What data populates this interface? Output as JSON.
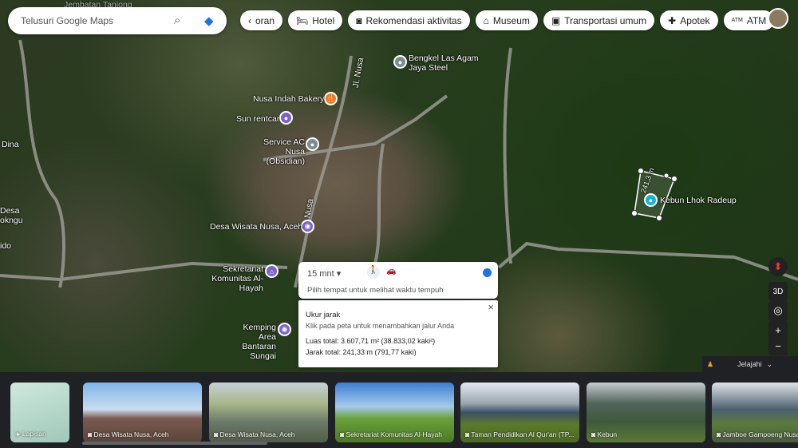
{
  "search": {
    "placeholder": "Telusuri Google Maps",
    "search_icon": "search-icon",
    "directions_icon": "directions-icon"
  },
  "chips": [
    {
      "label": "oran",
      "icon": "chevron-left"
    },
    {
      "label": "Hotel",
      "icon": "bed"
    },
    {
      "label": "Rekomendasi aktivitas",
      "icon": "camera"
    },
    {
      "label": "Museum",
      "icon": "museum"
    },
    {
      "label": "Transportasi umum",
      "icon": "bus"
    },
    {
      "label": "Apotek",
      "icon": "pharmacy"
    },
    {
      "label": "ATM",
      "icon": "atm"
    }
  ],
  "map_labels": {
    "bengkel": "Bengkel Las Agam Jaya Steel",
    "bakery": "Nusa Indah Bakery",
    "rentcar": "Sun rentcar",
    "service": "Service AC Nusa (Obsidian)",
    "desa": "Desa Wisata Nusa, Aceh",
    "sekretariat": "Sekretariat Komunitas Al-Hayah",
    "kemping": "Kemping Area Bantaran Sungai",
    "kebun": "Kebun Lhok Radeup",
    "jl_nusa": "Jl. Nusa",
    "nusa": "Nusa",
    "measure": "241,3 m",
    "left1": "Dina",
    "left2": "Desa",
    "left3": "okngu",
    "left4": "ido",
    "top_faded": "Jembatan Tanjong"
  },
  "travel": {
    "time": "15 mnt",
    "hint": "Pilih tempat untuk melihat waktu tempuh"
  },
  "measure": {
    "title": "Ukur jarak",
    "hint": "Klik pada peta untuk menambahkan jalur Anda",
    "area": "Luas total: 3.607,71 m² (38.833,02 kaki²)",
    "distance": "Jarak total: 241,33 m (791,77 kaki)"
  },
  "controls": {
    "tilt": "3D",
    "zoom_in": "+",
    "zoom_out": "−",
    "explore": "Jelajahi"
  },
  "layers_label": "Lapisan",
  "cards": [
    "Desa Wisata Nusa, Aceh",
    "Desa Wisata Nusa, Aceh",
    "Sekretariat Komunitas Al-Hayah",
    "Taman Pendidikan Al Qur'an (TP...",
    "Kebun",
    "Jamboe Gampoeng Nusa"
  ],
  "colors": {
    "accent": "#1a73e8",
    "poi_purple": "#7b61c9",
    "poi_orange": "#f07c1c",
    "poi_gray": "#7c8a94",
    "poi_teal": "#12b5cb"
  }
}
